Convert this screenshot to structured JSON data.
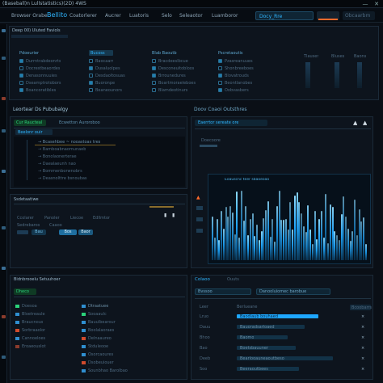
{
  "window": {
    "title": "(Baseball)n Lullstatistics)(2D) 4WS",
    "minimize": "—",
    "close": "✕"
  },
  "menubar": {
    "items": [
      "Browser Orabe",
      "Bellito",
      "Coatorlerer",
      "Aucrer",
      "Luatoris",
      "Selo",
      "Seleaotor",
      "Luamboror"
    ],
    "tab_active": "Docy_Rre",
    "tab_url": "Obcaarbm"
  },
  "top_panel": {
    "header": "Deep 00) Uluted Faviols",
    "columns": [
      {
        "heading": "Pdoeurier",
        "items": [
          "Durrntrabdeonrts",
          "Docrestbeaordes",
          "Denasonnuuies",
          "Dseamptrotobors",
          "Boancoratibles"
        ]
      },
      {
        "heading": "Bucoss",
        "items": [
          "Baocaarr",
          "Dusaluolpes",
          "Desdaoltosuas",
          "Buoronpe",
          "Beaneounors"
        ]
      },
      {
        "heading": "Blab Baoutb",
        "items": [
          "Bracdeeslbcue",
          "Desconeuitobloos",
          "Brrounedures",
          "Boartmoraeleboes",
          "Blamdeotinurs"
        ]
      },
      {
        "heading": "Pscretaoutis",
        "items": [
          "Pzasreanuues",
          "Shonbreeboes",
          "Blovatrouds",
          "Beontlanobes",
          "Oobvasbers"
        ]
      }
    ],
    "right_labels": [
      "Tlauser",
      "Bluses",
      "Baons"
    ]
  },
  "section_label_left": "Leortear Ds Pububalgy",
  "section_label_right": "Doov Coaoi Outsthres",
  "console": {
    "title_a": "Cur Raucteal",
    "title_b": "Ecwetton Auroroboo",
    "tab": "Beelonr ouir",
    "lines": [
      "→ Bcasehbee ~ nooastoas tres",
      "→ Bamboabnaomunaeb",
      "→ Bonolaonerterae",
      "→ Daealaeunh nao",
      "→ Bommenborwnobrs",
      "→ Deasnolttre bsnoubas"
    ]
  },
  "histogram": {
    "header": "Eaerrtor sereate ore",
    "sub": "Doecoore",
    "title": "Eoauscnc teer sbaoeoao"
  },
  "settings": {
    "title": "Ssdetaatiwe",
    "rows": [
      [
        "Ccolarer",
        "Panoler",
        "Liecoe",
        "Edllmtor"
      ],
      [
        "Sedrebaros",
        "Caaoo"
      ]
    ],
    "buttons": [
      "Bau",
      "Bos",
      "Baor"
    ]
  },
  "file_panel": {
    "title": "Bidnbrooelu Setuuhoer",
    "header_badge": "Dheco",
    "left": [
      "Doesoa",
      "Bloetreaule",
      "Braucnous",
      "Sorbraaolor",
      "Cannoeloes",
      "Eroaeouslot"
    ],
    "right": [
      "Dtraatuee",
      "Sooaaulc",
      "Bauulbearour",
      "Boolalaoraes",
      "Delnaaureo",
      "Stduleooe",
      "Osorcaoures",
      "Dsobeuiouer",
      "Sounbhao Barolbao"
    ]
  },
  "log_panel": {
    "title": "Colaoo",
    "subtitle": "Ouuts",
    "search": "Bvssoo",
    "filter": "Danooluiomec barobue",
    "col_a": "Leer",
    "col_b": "Berlueane",
    "right_badge": "Bcoobarrs",
    "rows": [
      {
        "a": "Lruo",
        "b": "Baodiaub bouhaed"
      },
      {
        "a": "Dauu",
        "b": "Bauoradsarloaed"
      },
      {
        "a": "Bhoo",
        "b": "Baomo"
      },
      {
        "a": "Bao",
        "b": "Boetsbauuner"
      },
      {
        "a": "Deeb",
        "b": "Bearlooauneaoutbeso"
      },
      {
        "a": "Soo",
        "b": "Beeraoutbees"
      }
    ]
  },
  "colors": {
    "accent": "#2fb6ff",
    "bg": "#0a0f16",
    "panel": "#0d141d",
    "green": "#2bd27a",
    "orange": "#ff6a2b"
  }
}
